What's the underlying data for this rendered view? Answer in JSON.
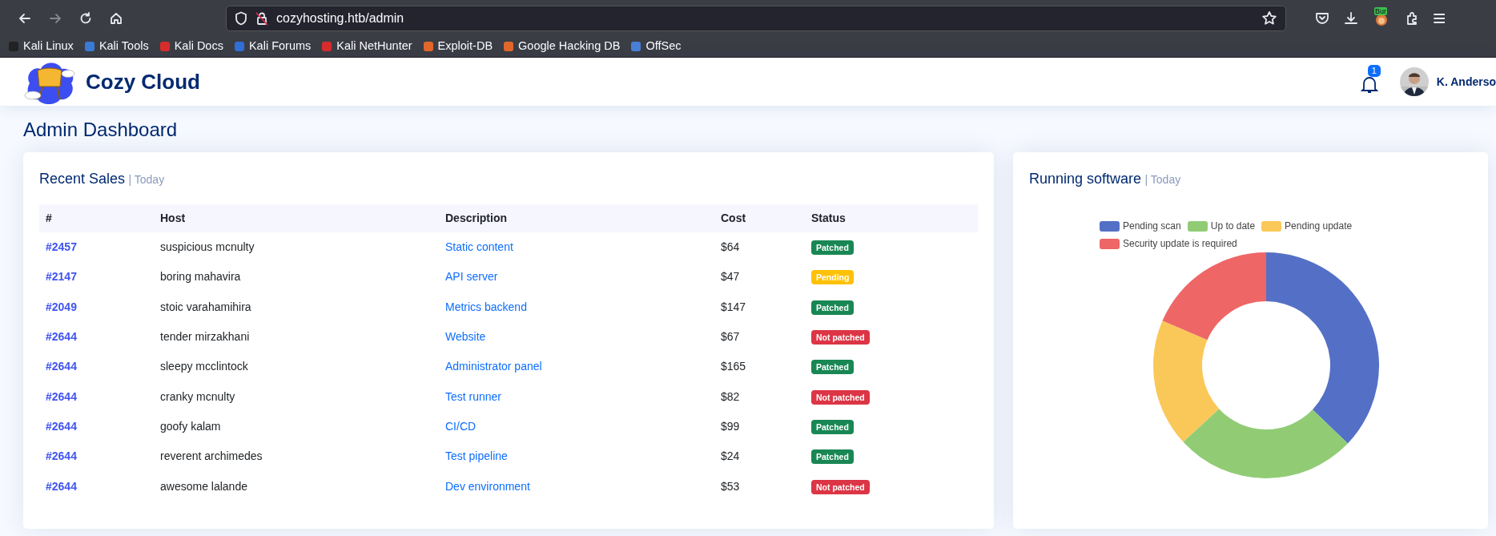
{
  "browser": {
    "url": "cozyhosting.htb/admin",
    "extension_badge": "Bur",
    "bookmarks": [
      {
        "label": "Kali Linux",
        "color": "#222222"
      },
      {
        "label": "Kali Tools",
        "color": "#3a7bd5"
      },
      {
        "label": "Kali Docs",
        "color": "#d62c2c"
      },
      {
        "label": "Kali Forums",
        "color": "#2f6fd6"
      },
      {
        "label": "Kali NetHunter",
        "color": "#d62c2c"
      },
      {
        "label": "Exploit-DB",
        "color": "#e0662a"
      },
      {
        "label": "Google Hacking DB",
        "color": "#e0662a"
      },
      {
        "label": "OffSec",
        "color": "#4a7fd8"
      }
    ]
  },
  "header": {
    "brand": "Cozy Cloud",
    "notification_count": "1",
    "user": "K. Anderso"
  },
  "page_title": "Admin Dashboard",
  "sales": {
    "title": "Recent Sales",
    "subtitle": "| Today",
    "columns": [
      "#",
      "Host",
      "Description",
      "Cost",
      "Status"
    ],
    "rows": [
      {
        "id": "#2457",
        "host": "suspicious mcnulty",
        "description": "Static content",
        "cost": "$64",
        "status": {
          "kind": "patched",
          "label": "Patched"
        }
      },
      {
        "id": "#2147",
        "host": "boring mahavira",
        "description": "API server",
        "cost": "$47",
        "status": {
          "kind": "pending",
          "label": "Pending"
        }
      },
      {
        "id": "#2049",
        "host": "stoic varahamihira",
        "description": "Metrics backend",
        "cost": "$147",
        "status": {
          "kind": "patched",
          "label": "Patched"
        }
      },
      {
        "id": "#2644",
        "host": "tender mirzakhani",
        "description": "Website",
        "cost": "$67",
        "status": {
          "kind": "not_patched",
          "label": "Not patched"
        }
      },
      {
        "id": "#2644",
        "host": "sleepy mcclintock",
        "description": "Administrator panel",
        "cost": "$165",
        "status": {
          "kind": "patched",
          "label": "Patched"
        }
      },
      {
        "id": "#2644",
        "host": "cranky mcnulty",
        "description": "Test runner",
        "cost": "$82",
        "status": {
          "kind": "not_patched",
          "label": "Not patched"
        }
      },
      {
        "id": "#2644",
        "host": "goofy kalam",
        "description": "CI/CD",
        "cost": "$99",
        "status": {
          "kind": "patched",
          "label": "Patched"
        }
      },
      {
        "id": "#2644",
        "host": "reverent archimedes",
        "description": "Test pipeline",
        "cost": "$24",
        "status": {
          "kind": "patched",
          "label": "Patched"
        }
      },
      {
        "id": "#2644",
        "host": "awesome lalande",
        "description": "Dev environment",
        "cost": "$53",
        "status": {
          "kind": "not_patched",
          "label": "Not patched"
        }
      }
    ]
  },
  "software": {
    "title": "Running software",
    "subtitle": "| Today",
    "legend": [
      {
        "label": "Pending scan",
        "color": "#5470c6"
      },
      {
        "label": "Up to date",
        "color": "#91cc75"
      },
      {
        "label": "Pending update",
        "color": "#fac858"
      },
      {
        "label": "Security update is required",
        "color": "#ee6666"
      }
    ]
  }
}
